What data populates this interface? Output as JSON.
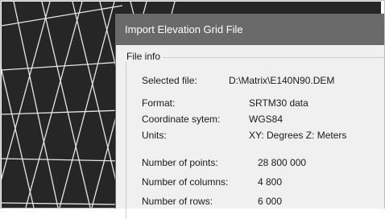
{
  "dialog": {
    "title": "Import Elevation Grid File",
    "group_label": "File info",
    "selected_file_label": "Selected file:",
    "selected_file_value": "D:\\Matrix\\E140N90.DEM",
    "format_label": "Format:",
    "format_value": "SRTM30 data",
    "coord_label": "Coordinate sytem:",
    "coord_value": "WGS84",
    "units_label": "Units:",
    "units_value": "XY: Degrees Z: Meters",
    "points_label": "Number of points:",
    "points_value": "28 800 000",
    "columns_label": "Number of columns:",
    "columns_value": "4 800",
    "rows_label": "Number of rows:",
    "rows_value": "6 000"
  },
  "colors": {
    "mesh_background": "#262626",
    "mesh_lines": "#e6e6e6",
    "titlebar": "#6a6a6a",
    "dialog_body": "#f0f0f0"
  }
}
